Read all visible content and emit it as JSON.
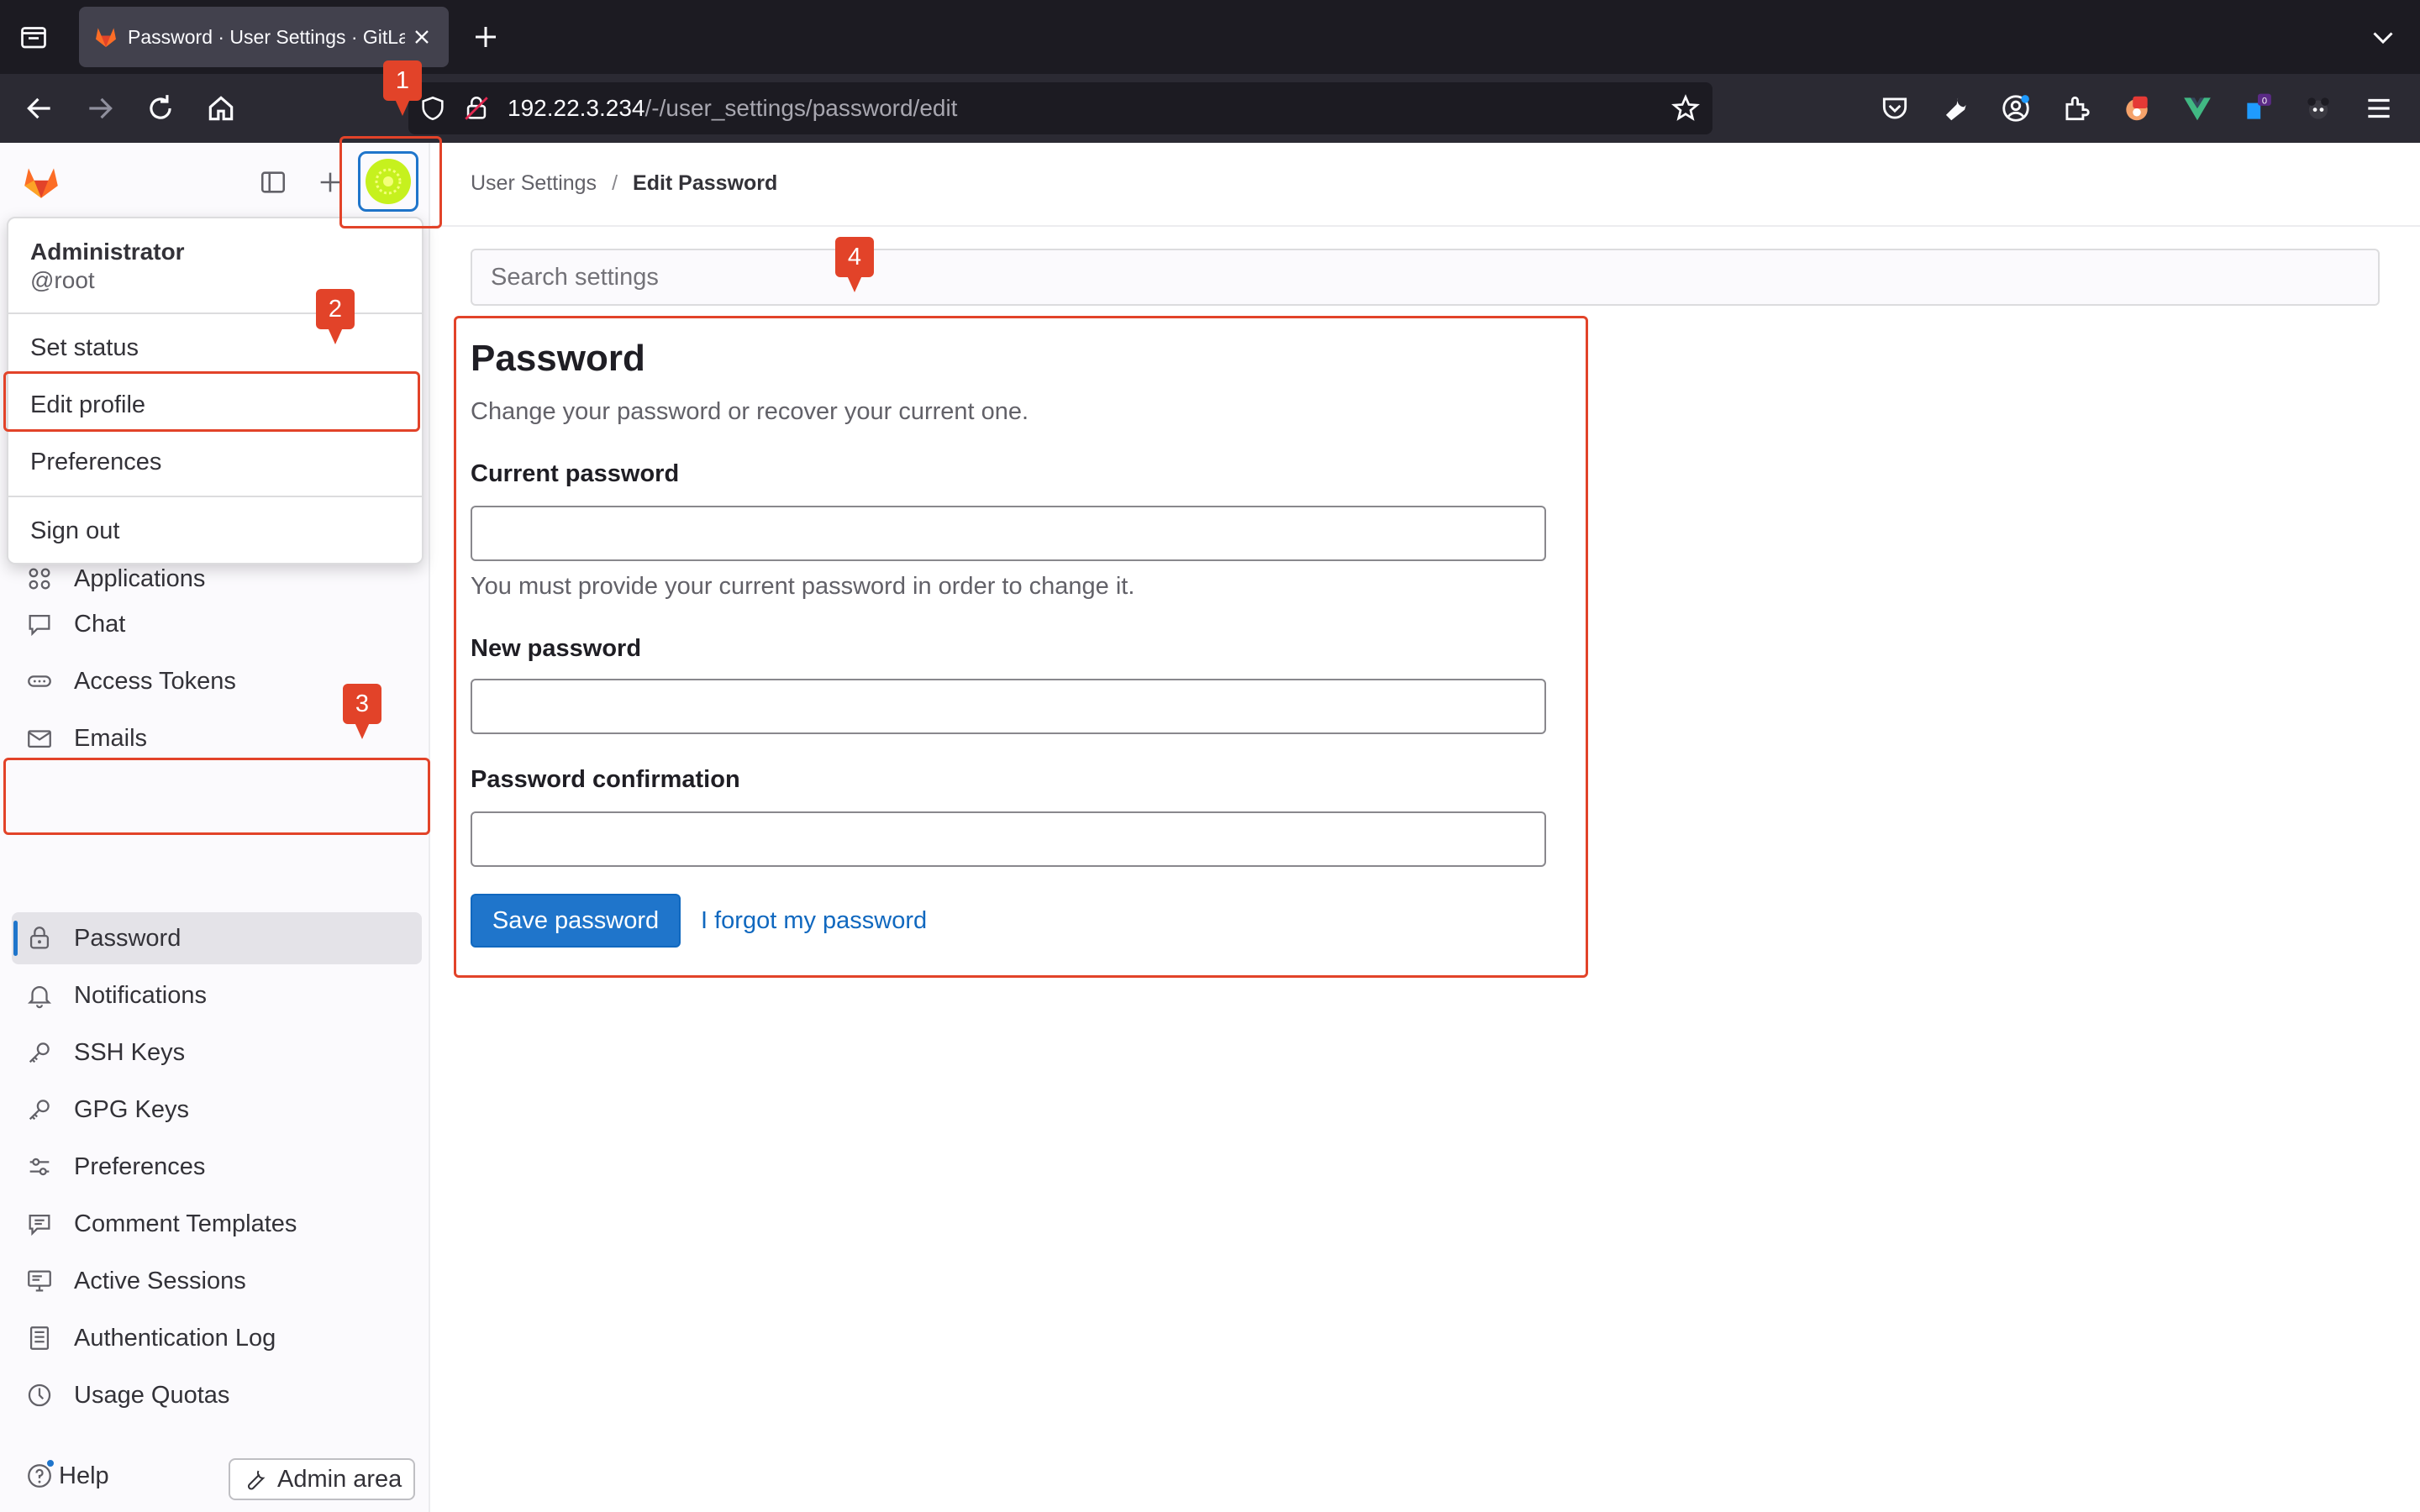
{
  "browser": {
    "tab_title": "Password · User Settings · GitLab",
    "url_host": "192.22.3.234",
    "url_path": "/-/user_settings/password/edit"
  },
  "sidebar": {
    "items": [
      {
        "label": "Applications",
        "icon": "applications-icon"
      },
      {
        "label": "Chat",
        "icon": "comment-icon"
      },
      {
        "label": "Access Tokens",
        "icon": "token-icon"
      },
      {
        "label": "Emails",
        "icon": "mail-icon"
      },
      {
        "label": "Password",
        "icon": "lock-icon",
        "active": true
      },
      {
        "label": "Notifications",
        "icon": "bell-icon"
      },
      {
        "label": "SSH Keys",
        "icon": "key-icon"
      },
      {
        "label": "GPG Keys",
        "icon": "key-icon"
      },
      {
        "label": "Preferences",
        "icon": "preferences-icon"
      },
      {
        "label": "Comment Templates",
        "icon": "comment-template-icon"
      },
      {
        "label": "Active Sessions",
        "icon": "monitor-icon"
      },
      {
        "label": "Authentication Log",
        "icon": "log-icon"
      },
      {
        "label": "Usage Quotas",
        "icon": "quota-icon"
      }
    ],
    "help_label": "Help",
    "admin_label": "Admin area"
  },
  "user_menu": {
    "name": "Administrator",
    "username": "@root",
    "items": [
      "Set status",
      "Edit profile",
      "Preferences",
      "Sign out"
    ]
  },
  "breadcrumb": {
    "parent": "User Settings",
    "separator": "/",
    "current": "Edit Password"
  },
  "search": {
    "placeholder": "Search settings"
  },
  "password_form": {
    "title": "Password",
    "description": "Change your password or recover your current one.",
    "current_label": "Current password",
    "current_help": "You must provide your current password in order to change it.",
    "new_label": "New password",
    "confirm_label": "Password confirmation",
    "save_label": "Save password",
    "forgot_label": "I forgot my password"
  },
  "annotations": [
    "1",
    "2",
    "3",
    "4"
  ],
  "colors": {
    "accent": "#1f75cb",
    "annotation": "#e24329",
    "gitlab_orange": "#fc6d26"
  }
}
